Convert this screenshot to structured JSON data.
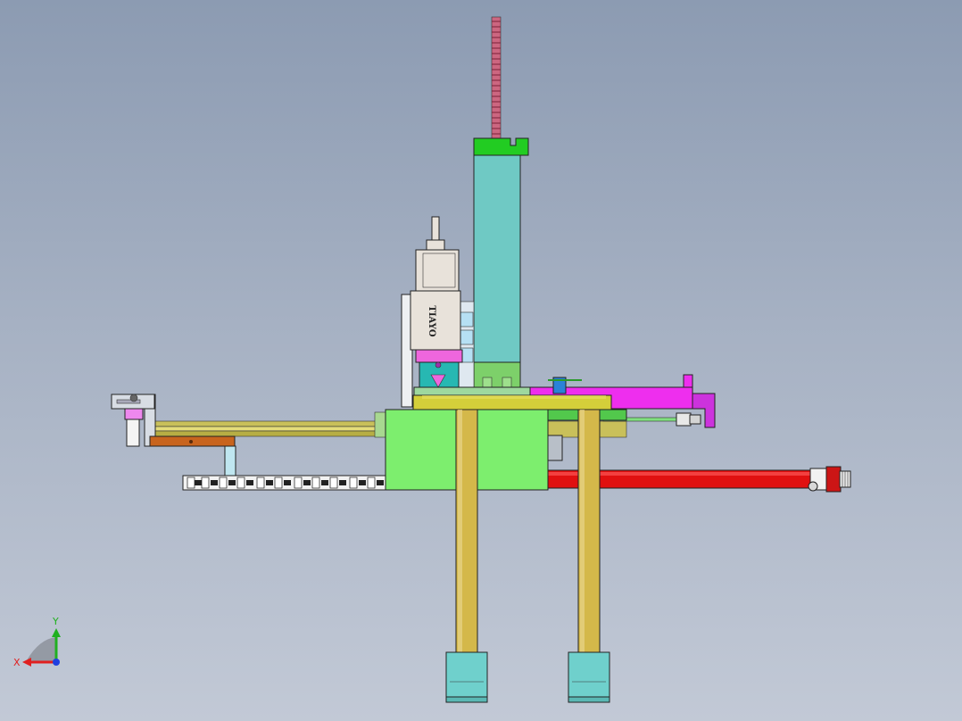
{
  "motor_label": "TIAYO",
  "triad": {
    "x_label": "X",
    "y_label": "Y",
    "x_color": "#e02020",
    "y_color": "#20b020",
    "z_color": "#2040e0"
  },
  "colors": {
    "background_top": "#8c9bb2",
    "background_bottom": "#c2c9d6",
    "column_cyan": "#6fc9c4",
    "cap_green": "#22cc22",
    "lead_screw_pink": "#cc6680",
    "housing_green": "#7dee6e",
    "leg_gold": "#d4b84a",
    "foot_cyan": "#6fd0cc",
    "bar_red": "#e01010",
    "arm_magenta": "#ee2eee",
    "plate_olive": "#d4cf3a",
    "bracket_orange": "#c8641e",
    "motor_gray": "#e8e2da"
  }
}
